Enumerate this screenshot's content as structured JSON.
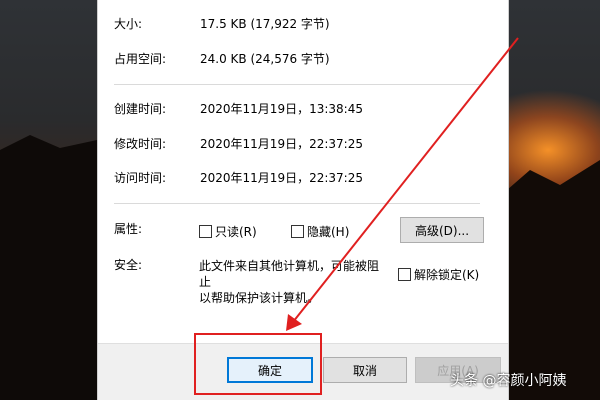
{
  "dialog": {
    "size_label": "大小:",
    "size_value": "17.5 KB (17,922 字节)",
    "disk_label": "占用空间:",
    "disk_value": "24.0 KB (24,576 字节)",
    "created_label": "创建时间:",
    "created_value": "2020年11月19日，13:38:45",
    "modified_label": "修改时间:",
    "modified_value": "2020年11月19日，22:37:25",
    "accessed_label": "访问时间:",
    "accessed_value": "2020年11月19日，22:37:25",
    "attributes_label": "属性:",
    "readonly_label": "只读(R)",
    "hidden_label": "隐藏(H)",
    "advanced_label": "高级(D)...",
    "security_label": "安全:",
    "security_line1": "此文件来自其他计算机，可能被阻止",
    "security_line2": "以帮助保护该计算机。",
    "unblock_label": "解除锁定(K)",
    "ok_label": "确定",
    "cancel_label": "取消",
    "apply_label": "应用(A)"
  },
  "watermark": {
    "text": "头条 @容颜小阿姨"
  },
  "colors": {
    "annotation": "#e02020",
    "ok_border": "#0078d7",
    "desktop_glow": "#ff9628"
  }
}
